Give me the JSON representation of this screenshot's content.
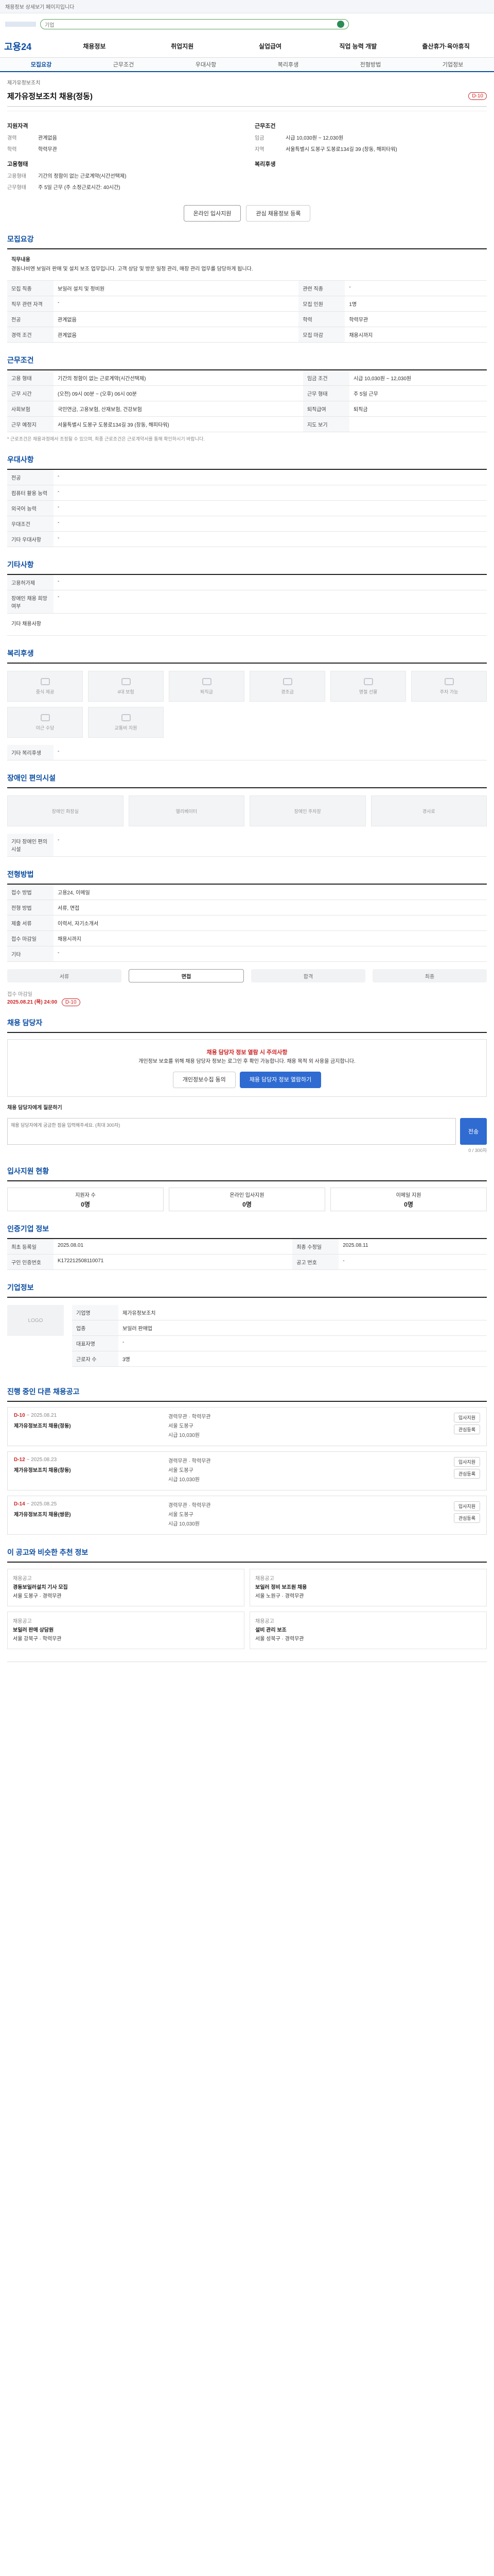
{
  "top": {
    "notice": "채용정보 상세보기 페이지입니다"
  },
  "search": {
    "placeholder": "기업",
    "label": "검색"
  },
  "gnb": {
    "logo": "고용24",
    "items": [
      "채용정보",
      "취업지원",
      "실업급여",
      "직업 능력 개발",
      "출산휴가·육아휴직"
    ]
  },
  "tabs": [
    "모집요강",
    "근무조건",
    "우대사항",
    "복리후생",
    "전형방법",
    "기업정보"
  ],
  "job": {
    "company": "제가유정보조치",
    "title": "제가유정보조치 채용(정동)",
    "dday": "D-10"
  },
  "summary": {
    "left_title": "지원자격",
    "left": [
      {
        "k": "경력",
        "v": "관계없음"
      },
      {
        "k": "학력",
        "v": "학력무관"
      }
    ],
    "left_title2": "고용형태",
    "left2": [
      {
        "k": "고용형태",
        "v": "기간의 정함이 없는 근로계약(시간선택제)"
      },
      {
        "k": "근무형태",
        "v": "주 5일 근무 (주 소정근로시간: 40시간)"
      }
    ],
    "right_title": "근무조건",
    "right": [
      {
        "k": "임금",
        "v": "시급 10,030원 ~ 12,030원"
      },
      {
        "k": "지역",
        "v": "서울특별시 도봉구 도봉로134길 39 (창동, 해피타워)"
      }
    ],
    "right_title2": "복리후생",
    "buttons": {
      "apply": "온라인 입사지원",
      "scrap": "관심 채용정보 등록"
    }
  },
  "recruit": {
    "title": "모집요강",
    "job_desc_title": "직무내용",
    "job_desc": "경동나비엔 보일러 판매 및 설치 보조 업무입니다. 고객 상담 및 방문 일정 관리, 매장 관리 업무를 담당하게 됩니다.",
    "rows": [
      {
        "k": "모집 직종",
        "v": "보일러 설치 및 정비원",
        "k2": "관련 직종",
        "v2": "-"
      },
      {
        "k": "직무 관련 자격",
        "v": "-",
        "k2": "모집 인원",
        "v2": "1명"
      },
      {
        "k": "전공",
        "v": "관계없음",
        "k2": "학력",
        "v2": "학력무관"
      },
      {
        "k": "경력 조건",
        "v": "관계없음",
        "k2": "모집 마감",
        "v2": "채용시까지"
      }
    ]
  },
  "conditions": {
    "title": "근무조건",
    "rows": [
      {
        "k": "고용 형태",
        "v": "기간의 정함이 없는 근로계약(시간선택제)",
        "k2": "임금 조건",
        "v2": "시급 10,030원 ~ 12,030원"
      },
      {
        "k": "근무 시간",
        "v": "(오전) 09시 00분 ~ (오후) 06시 00분",
        "k2": "근무 형태",
        "v2": "주 5일 근무"
      },
      {
        "k": "사회보험",
        "v": "국민연금, 고용보험, 산재보험, 건강보험",
        "k2": "퇴직급여",
        "v2": "퇴직금"
      },
      {
        "k": "근무 예정지",
        "v": "서울특별시 도봉구 도봉로134길 39 (창동, 해피타워)",
        "k2": "지도 보기",
        "v2": ""
      }
    ],
    "note": "* 근로조건은 채용과정에서 조정될 수 있으며, 최종 근로조건은 근로계약서를 통해 확인하시기 바랍니다."
  },
  "preference": {
    "title": "우대사항",
    "rows": [
      {
        "k": "전공",
        "v": "-"
      },
      {
        "k": "컴퓨터 활용 능력",
        "v": "-"
      },
      {
        "k": "외국어 능력",
        "v": "-"
      },
      {
        "k": "우대조건",
        "v": "-"
      },
      {
        "k": "기타 우대사항",
        "v": "-"
      }
    ]
  },
  "etc": {
    "title": "기타사항",
    "rows": [
      {
        "k": "고용허가제",
        "v": "-"
      },
      {
        "k": "장애인 채용 희망 여부",
        "v": "-"
      }
    ],
    "extra": "기타 채용사항"
  },
  "welfare": {
    "title": "복리후생",
    "items": [
      "중식 제공",
      "4대 보험",
      "퇴직금",
      "경조금",
      "명절 선물",
      "주차 가능",
      "야근 수당",
      "교통비 지원"
    ],
    "extra_label": "기타 복리후생",
    "extra_value": "-"
  },
  "disability": {
    "title": "장애인 편의시설",
    "items": [
      "장애인 화장실",
      "엘리베이터",
      "장애인 주차장",
      "경사로"
    ],
    "extra_label": "기타 장애인 편의시설",
    "extra_value": "-"
  },
  "selection": {
    "title": "전형방법",
    "rows": [
      {
        "k": "접수 방법",
        "v": "고용24, 이메일"
      },
      {
        "k": "전형 방법",
        "v": "서류, 면접"
      },
      {
        "k": "제출 서류",
        "v": "이력서, 자기소개서"
      },
      {
        "k": "접수 마감일",
        "v": "채용시까지"
      },
      {
        "k": "기타",
        "v": "-"
      }
    ],
    "steps": [
      "서류",
      "면접",
      "합격",
      "최종"
    ],
    "deadline_label": "접수 마감일",
    "deadline_value": "2025.08.21 (목) 24:00",
    "deadline_badge": "D-10"
  },
  "manager": {
    "title": "채용 담당자",
    "warn": "채용 담당자 정보 열람 시 주의사항",
    "notice": "개인정보 보호를 위해 채용 담당자 정보는 로그인 후 확인 가능합니다. 채용 목적 외 사용을 금지합니다.",
    "btn1": "개인정보수집 동의",
    "btn2": "채용 담당자 정보 열람하기",
    "qa_label": "채용 담당자에게 질문하기",
    "qa_placeholder": "채용 담당자에게 궁금한 점을 입력해주세요. (최대 300자)",
    "qa_send": "전송",
    "qa_count": "0 / 300자"
  },
  "applicants": {
    "title": "입사지원 현황",
    "stats": [
      {
        "label": "지원자 수",
        "value": "0명"
      },
      {
        "label": "온라인 입사지원",
        "value": "0명"
      },
      {
        "label": "이메일 지원",
        "value": "0명"
      }
    ]
  },
  "info": {
    "title": "인증기업 정보",
    "rows": [
      {
        "k": "최초 등록일",
        "v": "2025.08.01",
        "k2": "최종 수정일",
        "v2": "2025.08.11"
      },
      {
        "k": "구인 인증번호",
        "v": "K172212508110071",
        "k2": "공고 번호",
        "v2": "-"
      }
    ]
  },
  "company": {
    "title": "기업정보",
    "logo_text": "LOGO",
    "rows": [
      {
        "k": "기업명",
        "v": "제가유정보조치"
      },
      {
        "k": "업종",
        "v": "보일러 판매업"
      },
      {
        "k": "대표자명",
        "v": "-"
      },
      {
        "k": "근로자 수",
        "v": "3명"
      }
    ]
  },
  "others": {
    "title": "진행 중인 다른 채용공고",
    "cards": [
      {
        "dday": "D-10",
        "date": "~ 2025.08.21",
        "title": "제가유정보조치 채용(정동)",
        "info1": "경력무관 · 학력무관",
        "info2": "서울 도봉구",
        "info3": "시급 10,030원"
      },
      {
        "dday": "D-12",
        "date": "~ 2025.08.23",
        "title": "제가유정보조치 채용(창동)",
        "info1": "경력무관 · 학력무관",
        "info2": "서울 도봉구",
        "info3": "시급 10,030원"
      },
      {
        "dday": "D-14",
        "date": "~ 2025.08.25",
        "title": "제가유정보조치 채용(쌍문)",
        "info1": "경력무관 · 학력무관",
        "info2": "서울 도봉구",
        "info3": "시급 10,030원"
      }
    ],
    "btn_apply": "입사지원",
    "btn_scrap": "관심등록"
  },
  "recommend": {
    "title": "이 공고와 비슷한 추천 정보",
    "items": [
      {
        "tag": "채용공고",
        "name": "경동보일러설치 기사 모집",
        "sub": "서울 도봉구 · 경력무관"
      },
      {
        "tag": "채용공고",
        "name": "보일러 정비 보조원 채용",
        "sub": "서울 노원구 · 경력무관"
      },
      {
        "tag": "채용공고",
        "name": "보일러 판매 상담원",
        "sub": "서울 강북구 · 학력무관"
      },
      {
        "tag": "채용공고",
        "name": "설비 관리 보조",
        "sub": "서울 성북구 · 경력무관"
      }
    ]
  }
}
